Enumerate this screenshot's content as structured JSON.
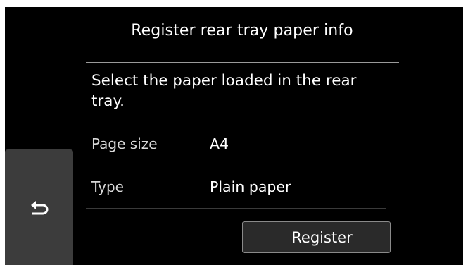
{
  "header": {
    "title": "Register rear tray paper info"
  },
  "main": {
    "message": "Select the paper loaded in the rear tray.",
    "settings": [
      {
        "label": "Page size",
        "value": "A4"
      },
      {
        "label": "Type",
        "value": "Plain paper"
      }
    ]
  },
  "footer": {
    "back_icon": "return-arrow-icon",
    "register_label": "Register"
  },
  "colors": {
    "screen_background": "#000000",
    "text": "#ffffff",
    "back_button_background": "#3c3c3c",
    "register_button_border": "#8a8a8a"
  }
}
